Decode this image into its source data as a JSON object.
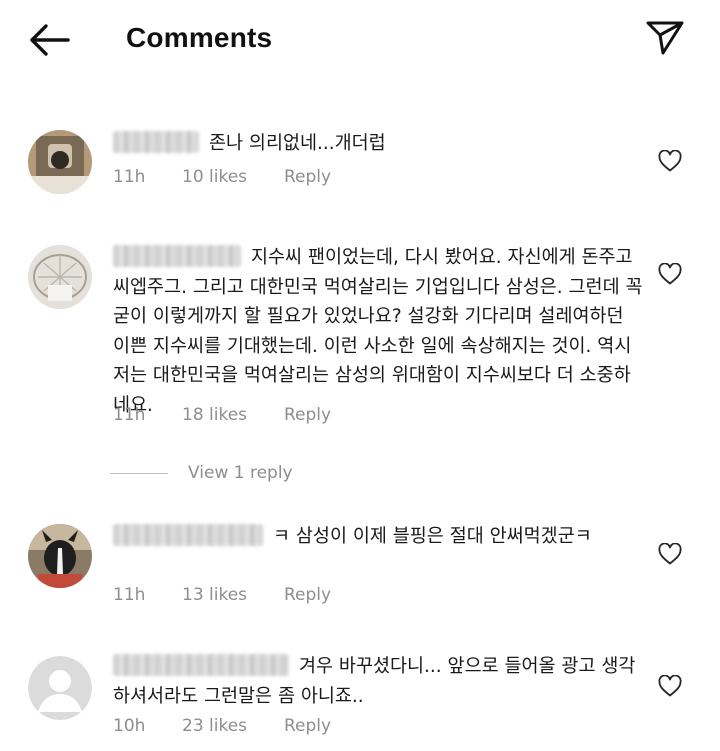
{
  "header": {
    "title": "Comments"
  },
  "comments": [
    {
      "text": "존나 의리없네...개더럽",
      "time": "11h",
      "likes": "10 likes",
      "reply_label": "Reply"
    },
    {
      "text": "지수씨 팬이었는데, 다시 봤어요. 자신에게 돈주고 씨엡주그. 그리고 대한민국 먹여살리는 기업입니다 삼성은. 그런데 꼭 굳이 이렇게까지 할 필요가 있었나요? 설강화 기다리며 설레여하던 이쁜 지수씨를 기대했는데. 이런 사소한 일에 속상해지는 것이. 역시 저는 대한민국을 먹여살리는 삼성의 위대함이 지수씨보다 더 소중하네요.",
      "time": "11h",
      "likes": "18 likes",
      "reply_label": "Reply",
      "view_replies": "View 1 reply"
    },
    {
      "text": "ㅋ 삼성이 이제 블핑은 절대 안써먹겠군ㅋ",
      "time": "11h",
      "likes": "13 likes",
      "reply_label": "Reply"
    },
    {
      "text": "겨우 바꾸셨다니... 앞으로 들어올 광고 생각하셔서라도 그런말은 좀 아니죠..",
      "time": "10h",
      "likes": "23 likes",
      "reply_label": "Reply"
    }
  ],
  "icons": {
    "back": "arrow-left-icon",
    "send": "paper-plane-icon",
    "like": "heart-outline-icon",
    "default_avatar": "default-user-avatar"
  },
  "colors": {
    "text": "#1a1a1a",
    "meta": "#8e8e8e",
    "background": "#ffffff"
  }
}
